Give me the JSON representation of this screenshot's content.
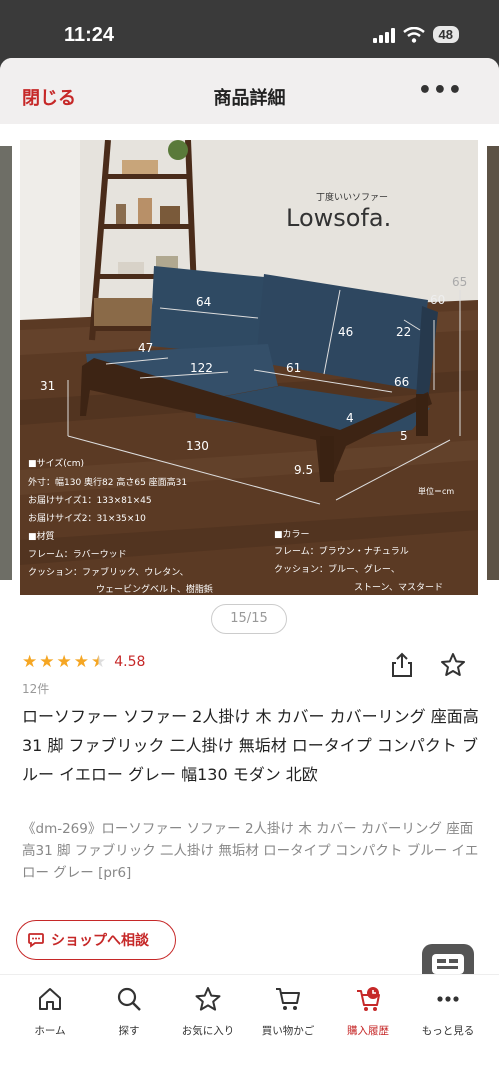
{
  "status_bar": {
    "time": "11:24",
    "battery": "48"
  },
  "header": {
    "close_label": "閉じる",
    "title": "商品詳細",
    "more_label": "•••"
  },
  "gallery": {
    "counter": "15/15",
    "image": {
      "brand_tag": "丁度いいソファー",
      "brand_name": "Lowsofa.",
      "dimensions": {
        "d64": "64",
        "d46": "46",
        "d22": "22",
        "d60": "60",
        "d65": "65",
        "d47": "47",
        "d122": "122",
        "d61": "61",
        "d66": "66",
        "d31": "31",
        "d4": "4",
        "d130": "130",
        "d5": "5",
        "d9_5": "9.5"
      },
      "unit_label": "単位＝cm",
      "spec_size_heading": "■サイズ(cm)",
      "spec_size_line1": "外寸：幅130 奥行82 高さ65 座面高31",
      "spec_size_line2": "お届けサイズ1：133×81×45",
      "spec_size_line3": "お届けサイズ2：31×35×10",
      "spec_material_heading": "■材質",
      "spec_material_line1": "フレーム：ラバーウッド",
      "spec_material_line2": "クッション：ファブリック、ウレタン、",
      "spec_material_line3": "ウェービングベルト、樹脂鋲",
      "spec_color_heading": "■カラー",
      "spec_color_line1": "フレーム：ブラウン・ナチュラル",
      "spec_color_line2": "クッション：ブルー、グレー、",
      "spec_color_line3": "ストーン、マスタード"
    }
  },
  "rating": {
    "value": "4.58",
    "stars": 4.5,
    "count": "12件"
  },
  "product": {
    "title": "ローソファー ソファー 2人掛け 木 カバー カバーリング 座面高31 脚 ファブリック 二人掛け 無垢材 ロータイプ コンパクト ブルー イエロー グレー 幅130 モダン 北欧",
    "subtitle": "《dm-269》ローソファー ソファー 2人掛け 木 カバー カバーリング 座面高31 脚 ファブリック 二人掛け 無垢材 ロータイプ コンパクト ブルー イエロー グレー [pr6]"
  },
  "shop_consult_label": "ショップへ相談",
  "nav": {
    "items": [
      {
        "label": "ホーム",
        "icon": "home-icon"
      },
      {
        "label": "探す",
        "icon": "search-icon"
      },
      {
        "label": "お気に入り",
        "icon": "star-icon"
      },
      {
        "label": "買い物かご",
        "icon": "cart-icon"
      },
      {
        "label": "購入履歴",
        "icon": "history-icon"
      },
      {
        "label": "もっと見る",
        "icon": "more-icon"
      }
    ]
  },
  "colors": {
    "accent": "#c62828",
    "star": "#f5a623",
    "sofa_fabric": "#2f4a63",
    "frame_wood": "#4a2c1a"
  }
}
